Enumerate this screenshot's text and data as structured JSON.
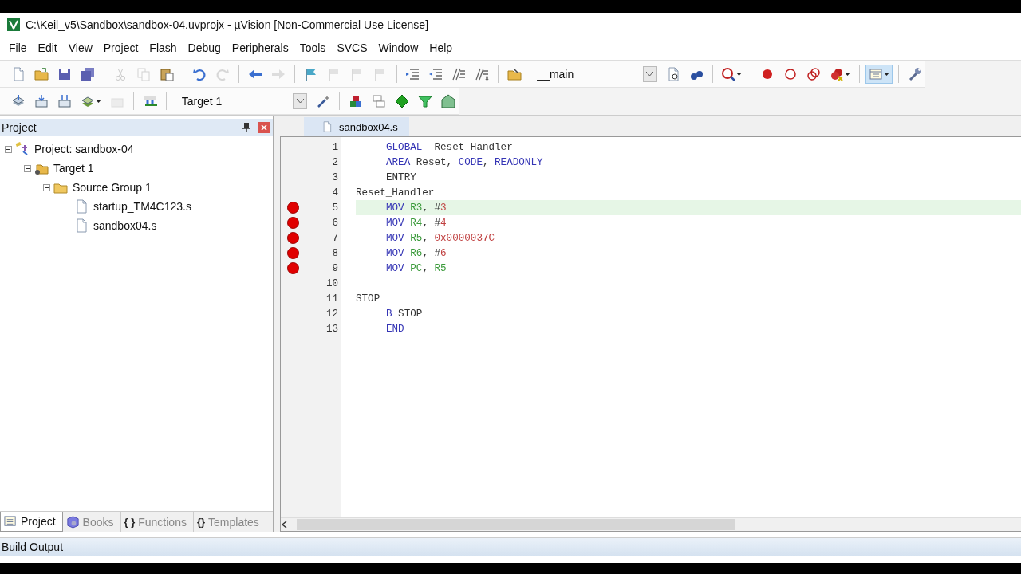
{
  "window": {
    "title": "C:\\Keil_v5\\Sandbox\\sandbox-04.uvprojx - µVision  [Non-Commercial Use License]"
  },
  "menu": [
    "File",
    "Edit",
    "View",
    "Project",
    "Flash",
    "Debug",
    "Peripherals",
    "Tools",
    "SVCS",
    "Window",
    "Help"
  ],
  "toolbar_1": [
    {
      "kind": "button",
      "disabled": false
    },
    {
      "kind": "button",
      "disabled": false
    },
    {
      "kind": "button",
      "disabled": false
    },
    {
      "kind": "button",
      "disabled": false
    },
    {
      "kind": "separator"
    },
    {
      "kind": "button",
      "disabled": true
    },
    {
      "kind": "button",
      "disabled": true
    },
    {
      "kind": "button",
      "disabled": false
    },
    {
      "kind": "separator"
    },
    {
      "kind": "button",
      "disabled": false
    },
    {
      "kind": "button",
      "disabled": true
    },
    {
      "kind": "separator"
    },
    {
      "kind": "button",
      "disabled": false
    },
    {
      "kind": "button",
      "disabled": true
    },
    {
      "kind": "separator"
    },
    {
      "kind": "button",
      "disabled": false
    },
    {
      "kind": "button",
      "disabled": true
    },
    {
      "kind": "button",
      "disabled": true
    },
    {
      "kind": "button",
      "disabled": true
    },
    {
      "kind": "separator"
    },
    {
      "kind": "button",
      "disabled": false
    },
    {
      "kind": "button",
      "disabled": false
    },
    {
      "kind": "button",
      "disabled": false
    },
    {
      "kind": "button",
      "disabled": false
    },
    {
      "kind": "separator"
    },
    {
      "kind": "button",
      "disabled": false
    },
    {
      "kind": "combo",
      "value": "__main"
    },
    {
      "kind": "button",
      "disabled": false
    },
    {
      "kind": "button",
      "disabled": false
    },
    {
      "kind": "separator"
    },
    {
      "kind": "button",
      "disabled": false,
      "menu": true
    },
    {
      "kind": "separator"
    },
    {
      "kind": "button",
      "disabled": false
    },
    {
      "kind": "button",
      "disabled": false
    },
    {
      "kind": "button",
      "disabled": false
    },
    {
      "kind": "button",
      "disabled": false,
      "menu": true
    },
    {
      "kind": "separator"
    },
    {
      "kind": "button",
      "disabled": false,
      "menu": true,
      "pressed": true
    },
    {
      "kind": "separator"
    },
    {
      "kind": "button",
      "disabled": false
    }
  ],
  "toolbar_2": [
    {
      "kind": "button",
      "disabled": false
    },
    {
      "kind": "button",
      "disabled": false
    },
    {
      "kind": "button",
      "disabled": false
    },
    {
      "kind": "button",
      "disabled": false,
      "menu": true
    },
    {
      "kind": "button",
      "disabled": true
    },
    {
      "kind": "separator"
    },
    {
      "kind": "button",
      "disabled": false
    },
    {
      "kind": "separator"
    },
    {
      "kind": "combo",
      "value": "Target 1"
    },
    {
      "kind": "button",
      "disabled": false
    },
    {
      "kind": "separator"
    },
    {
      "kind": "button",
      "disabled": false
    },
    {
      "kind": "button",
      "disabled": false
    },
    {
      "kind": "button",
      "disabled": false
    },
    {
      "kind": "button",
      "disabled": false
    },
    {
      "kind": "button",
      "disabled": false
    }
  ],
  "project_panel": {
    "title": "Project",
    "tree": [
      {
        "label": "Project: sandbox-04",
        "kind": "project",
        "expanded": true,
        "children": [
          {
            "label": "Target 1",
            "kind": "target",
            "expanded": true,
            "children": [
              {
                "label": "Source Group 1",
                "kind": "group",
                "expanded": true,
                "children": [
                  {
                    "label": "startup_TM4C123.s",
                    "kind": "file"
                  },
                  {
                    "label": "sandbox04.s",
                    "kind": "file"
                  }
                ]
              }
            ]
          }
        ]
      }
    ],
    "tabs": [
      {
        "label": "Project",
        "selected": true
      },
      {
        "label": "Books",
        "selected": false
      },
      {
        "label": "Functions",
        "glyph": "{ }",
        "selected": false
      },
      {
        "label": "Templates",
        "glyph": "{}",
        "selected": false
      }
    ]
  },
  "editor": {
    "tabs": [
      {
        "label": "sandbox04.s",
        "selected": true
      }
    ],
    "lines": [
      {
        "number": "1",
        "breakpoint": false,
        "current": false,
        "tokens": [
          {
            "kind": "indent"
          },
          {
            "kind": "keyword",
            "text": "GLOBAL"
          },
          {
            "kind": "plain",
            "text": "  Reset_Handler"
          }
        ]
      },
      {
        "number": "2",
        "breakpoint": false,
        "current": false,
        "tokens": [
          {
            "kind": "indent"
          },
          {
            "kind": "keyword",
            "text": "AREA"
          },
          {
            "kind": "plain",
            "text": " Reset, "
          },
          {
            "kind": "keyword",
            "text": "CODE"
          },
          {
            "kind": "plain",
            "text": ", "
          },
          {
            "kind": "keyword",
            "text": "READONLY"
          }
        ]
      },
      {
        "number": "3",
        "breakpoint": false,
        "current": false,
        "tokens": [
          {
            "kind": "indent"
          },
          {
            "kind": "plain",
            "text": "ENTRY"
          }
        ]
      },
      {
        "number": "4",
        "breakpoint": false,
        "current": false,
        "tokens": [
          {
            "kind": "plain",
            "text": "Reset_Handler"
          }
        ]
      },
      {
        "number": "5",
        "breakpoint": true,
        "current": true,
        "tokens": [
          {
            "kind": "indent"
          },
          {
            "kind": "keyword",
            "text": "MOV"
          },
          {
            "kind": "register",
            "text": " R3"
          },
          {
            "kind": "plain",
            "text": ", #"
          },
          {
            "kind": "number",
            "text": "3"
          }
        ]
      },
      {
        "number": "6",
        "breakpoint": true,
        "current": false,
        "tokens": [
          {
            "kind": "indent"
          },
          {
            "kind": "keyword",
            "text": "MOV"
          },
          {
            "kind": "register",
            "text": " R4"
          },
          {
            "kind": "plain",
            "text": ", #"
          },
          {
            "kind": "number",
            "text": "4"
          }
        ]
      },
      {
        "number": "7",
        "breakpoint": true,
        "current": false,
        "tokens": [
          {
            "kind": "indent"
          },
          {
            "kind": "keyword",
            "text": "MOV"
          },
          {
            "kind": "register",
            "text": " R5"
          },
          {
            "kind": "plain",
            "text": ", "
          },
          {
            "kind": "number",
            "text": "0x0000037C"
          }
        ]
      },
      {
        "number": "8",
        "breakpoint": true,
        "current": false,
        "tokens": [
          {
            "kind": "indent"
          },
          {
            "kind": "keyword",
            "text": "MOV"
          },
          {
            "kind": "register",
            "text": " R6"
          },
          {
            "kind": "plain",
            "text": ", #"
          },
          {
            "kind": "number",
            "text": "6"
          }
        ]
      },
      {
        "number": "9",
        "breakpoint": true,
        "current": false,
        "tokens": [
          {
            "kind": "indent"
          },
          {
            "kind": "keyword",
            "text": "MOV"
          },
          {
            "kind": "register",
            "text": " PC"
          },
          {
            "kind": "plain",
            "text": ", "
          },
          {
            "kind": "register",
            "text": "R5"
          }
        ]
      },
      {
        "number": "10",
        "breakpoint": false,
        "current": false
      },
      {
        "number": "11",
        "breakpoint": false,
        "current": false,
        "tokens": [
          {
            "kind": "plain",
            "text": "STOP"
          }
        ]
      },
      {
        "number": "12",
        "breakpoint": false,
        "current": false,
        "tokens": [
          {
            "kind": "indent"
          },
          {
            "kind": "keyword",
            "text": "B"
          },
          {
            "kind": "plain",
            "text": " STOP"
          }
        ]
      },
      {
        "number": "13",
        "breakpoint": false,
        "current": false,
        "tokens": [
          {
            "kind": "indent"
          },
          {
            "kind": "keyword",
            "text": "END"
          }
        ]
      }
    ]
  },
  "build_output": {
    "title": "Build Output"
  }
}
